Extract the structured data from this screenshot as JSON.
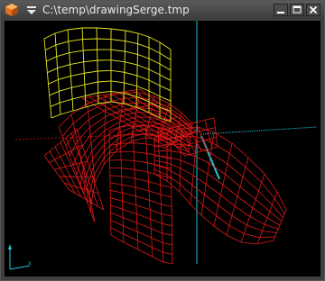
{
  "window": {
    "title": "C:\\temp\\drawingSerge.tmp"
  },
  "icons": {
    "app": "cube-icon",
    "menu": "menu-arrow-icon",
    "minimize": "minimize-icon",
    "maximize": "maximize-icon",
    "close": "close-icon"
  },
  "colors": {
    "background": "#000000",
    "wireframe_main": "#e01818",
    "wireframe_selected": "#e8e820",
    "axes": "#22c8d8",
    "axis_x_red": "#c01010"
  },
  "viewport": {
    "axis_indicator": {
      "x_label": "x",
      "y_label": ""
    }
  }
}
